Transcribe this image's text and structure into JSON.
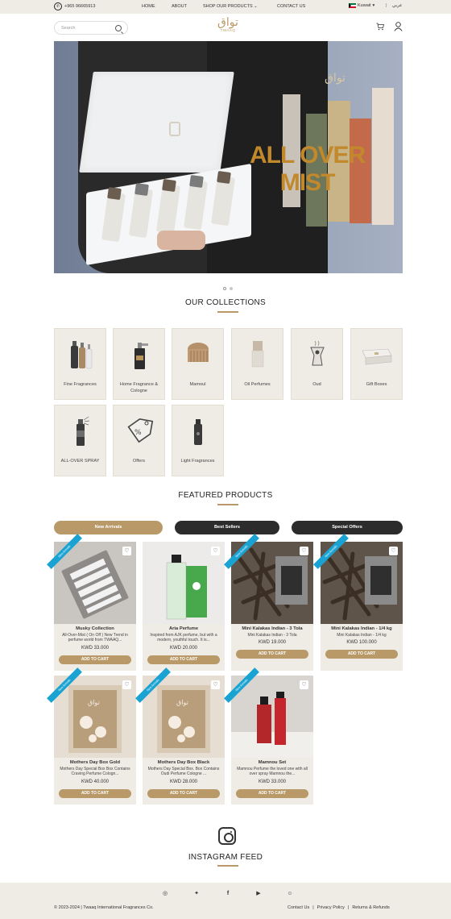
{
  "topbar": {
    "phone": "+965 96665913",
    "nav": [
      "HOME",
      "ABOUT",
      "SHOP OUR PRODUCTS",
      "CONTACT US"
    ],
    "country": "Kuwait",
    "language": "عربي"
  },
  "header": {
    "search_placeholder": "Search",
    "logo_arabic": "تواق",
    "logo_english": "TWAAQ"
  },
  "hero": {
    "headline_line1": "ALL OVER",
    "headline_line2": "MIST",
    "slide_count": 2,
    "active_slide": 1
  },
  "collections": {
    "title": "OUR COLLECTIONS",
    "items": [
      {
        "label": "Fine Fragrances",
        "icon": "perfume-bottles-icon"
      },
      {
        "label": "Home Fragrance & Cologne",
        "icon": "spray-bottle-icon"
      },
      {
        "label": "Mamoul",
        "icon": "mamoul-incense-icon"
      },
      {
        "label": "Oil Perfumes",
        "icon": "oil-bottle-icon"
      },
      {
        "label": "Oud",
        "icon": "oud-burner-icon"
      },
      {
        "label": "Gift Boxes",
        "icon": "gift-box-icon"
      },
      {
        "label": "ALL-OVER SPRAY",
        "icon": "body-spray-icon"
      },
      {
        "label": "Offers",
        "icon": "discount-tag-icon"
      },
      {
        "label": "Light Fragrances",
        "icon": "light-fragrance-icon"
      }
    ]
  },
  "featured": {
    "title": "FEATURED PRODUCTS",
    "tabs": [
      "New Arrivals",
      "Best Sellers",
      "Special Offers"
    ],
    "active_tab": "New Arrivals",
    "ribbon": "New Arrivals",
    "add_to_cart": "ADD TO CART",
    "products": [
      {
        "name": "Musky Collection",
        "desc": "All-Over-Mist ( On Off ) New Trend in perfume world from TWAAQ...",
        "price": "KWD 33.000"
      },
      {
        "name": "Aria Perfume",
        "desc": "Inspired from AJK perfume, but with a modern, youthful touch. It is...",
        "price": "KWD 20.000"
      },
      {
        "name": "Mini Kalakas Indian - 3 Tola",
        "desc": "Mini Kalakas Indian - 3 Tola",
        "price": "KWD 19.000"
      },
      {
        "name": "Mini Kalakas Indian - 1/4 kg",
        "desc": "Mini Kalakas Indian - 1/4 kg",
        "price": "KWD 100.000"
      },
      {
        "name": "Mothers Day Box Gold",
        "desc": "Mothers Day Special Box Box Contains Craving Perfume Cologn...",
        "price": "KWD 40.000"
      },
      {
        "name": "Mothers Day Box Black",
        "desc": "Mothers Day Special Box. Box Contains Oudi Perfume Cologne ...",
        "price": "KWD 28.000"
      },
      {
        "name": "Mamnou Set",
        "desc": "Mamnou Perfume the loved one with all over spray Mamnou the...",
        "price": "KWD 33.000"
      }
    ]
  },
  "instagram": {
    "title": "INSTAGRAM FEED"
  },
  "footer": {
    "social": [
      "instagram-icon",
      "twitter-icon",
      "facebook-icon",
      "youtube-icon",
      "snapchat-icon"
    ],
    "copyright": "© 2023-2024 | Twaaq International Fragrances Co.",
    "links": [
      "Contact Us",
      "Privacy Policy",
      "Returns & Refunds"
    ]
  },
  "colors": {
    "accent": "#b89967",
    "panel": "#efece6",
    "dark_tab": "#2c2c2c",
    "ribbon": "#19a3d3"
  }
}
